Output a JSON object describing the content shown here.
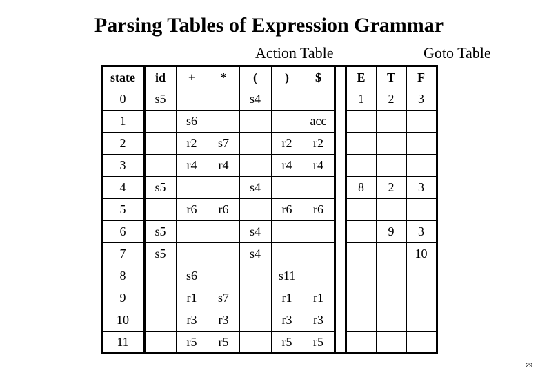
{
  "title": "Parsing Tables of Expression Grammar",
  "section_action": "Action Table",
  "section_goto": "Goto Table",
  "page_number": "29",
  "headers": {
    "state": "state",
    "action": [
      "id",
      "+",
      "*",
      "(",
      ")",
      "$"
    ],
    "goto": [
      "E",
      "T",
      "F"
    ]
  },
  "chart_data": {
    "type": "table",
    "title": "Parsing Tables of Expression Grammar",
    "action_columns": [
      "id",
      "+",
      "*",
      "(",
      ")",
      "$"
    ],
    "goto_columns": [
      "E",
      "T",
      "F"
    ],
    "rows": [
      {
        "state": "0",
        "action": {
          "id": "s5",
          "(": "s4"
        },
        "goto": {
          "E": "1",
          "T": "2",
          "F": "3"
        }
      },
      {
        "state": "1",
        "action": {
          "+": "s6",
          "$": "acc"
        },
        "goto": {}
      },
      {
        "state": "2",
        "action": {
          "+": "r2",
          "*": "s7",
          ")": "r2",
          "$": "r2"
        },
        "goto": {}
      },
      {
        "state": "3",
        "action": {
          "+": "r4",
          "*": "r4",
          ")": "r4",
          "$": "r4"
        },
        "goto": {}
      },
      {
        "state": "4",
        "action": {
          "id": "s5",
          "(": "s4"
        },
        "goto": {
          "E": "8",
          "T": "2",
          "F": "3"
        }
      },
      {
        "state": "5",
        "action": {
          "+": "r6",
          "*": "r6",
          ")": "r6",
          "$": "r6"
        },
        "goto": {}
      },
      {
        "state": "6",
        "action": {
          "id": "s5",
          "(": "s4"
        },
        "goto": {
          "T": "9",
          "F": "3"
        }
      },
      {
        "state": "7",
        "action": {
          "id": "s5",
          "(": "s4"
        },
        "goto": {
          "F": "10"
        }
      },
      {
        "state": "8",
        "action": {
          "+": "s6",
          ")": "s11"
        },
        "goto": {}
      },
      {
        "state": "9",
        "action": {
          "+": "r1",
          "*": "s7",
          ")": "r1",
          "$": "r1"
        },
        "goto": {}
      },
      {
        "state": "10",
        "action": {
          "+": "r3",
          "*": "r3",
          ")": "r3",
          "$": "r3"
        },
        "goto": {}
      },
      {
        "state": "11",
        "action": {
          "+": "r5",
          "*": "r5",
          ")": "r5",
          "$": "r5"
        },
        "goto": {}
      }
    ]
  }
}
